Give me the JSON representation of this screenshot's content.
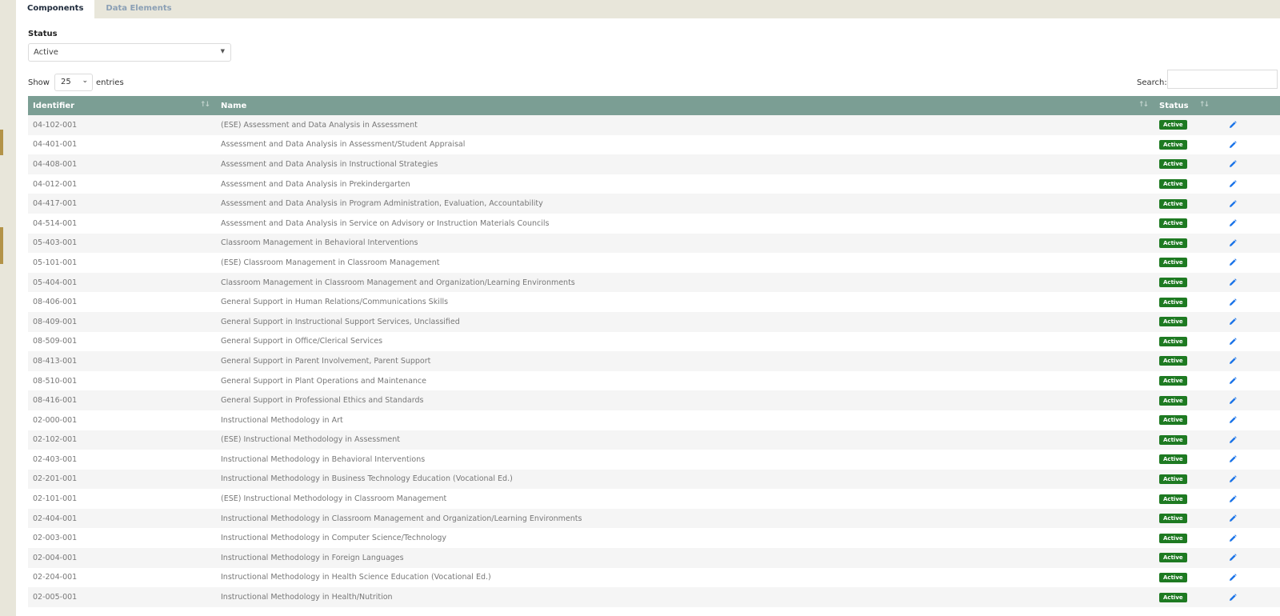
{
  "tabs": [
    {
      "label": "Components",
      "active": true
    },
    {
      "label": "Data Elements",
      "active": false
    }
  ],
  "filter": {
    "status_label": "Status",
    "status_value": "Active"
  },
  "length": {
    "show_label": "Show",
    "value": "25",
    "entries_label": "entries"
  },
  "search": {
    "label": "Search:",
    "value": ""
  },
  "table": {
    "columns": [
      "Identifier",
      "Name",
      "Status",
      ""
    ],
    "rows": [
      {
        "id": "04-102-001",
        "name": "(ESE) Assessment and Data Analysis in Assessment",
        "status": "Active"
      },
      {
        "id": "04-401-001",
        "name": "Assessment and Data Analysis in Assessment/Student Appraisal",
        "status": "Active"
      },
      {
        "id": "04-408-001",
        "name": "Assessment and Data Analysis in Instructional Strategies",
        "status": "Active"
      },
      {
        "id": "04-012-001",
        "name": "Assessment and Data Analysis in Prekindergarten",
        "status": "Active"
      },
      {
        "id": "04-417-001",
        "name": "Assessment and Data Analysis in Program Administration, Evaluation, Accountability",
        "status": "Active"
      },
      {
        "id": "04-514-001",
        "name": "Assessment and Data Analysis in Service on Advisory or Instruction Materials Councils",
        "status": "Active"
      },
      {
        "id": "05-403-001",
        "name": "Classroom Management in Behavioral Interventions",
        "status": "Active"
      },
      {
        "id": "05-101-001",
        "name": "(ESE) Classroom Management in Classroom Management",
        "status": "Active"
      },
      {
        "id": "05-404-001",
        "name": "Classroom Management in Classroom Management and Organization/Learning Environments",
        "status": "Active"
      },
      {
        "id": "08-406-001",
        "name": "General Support in Human Relations/Communications Skills",
        "status": "Active"
      },
      {
        "id": "08-409-001",
        "name": "General Support in Instructional Support Services, Unclassified",
        "status": "Active"
      },
      {
        "id": "08-509-001",
        "name": "General Support in Office/Clerical Services",
        "status": "Active"
      },
      {
        "id": "08-413-001",
        "name": "General Support in Parent Involvement, Parent Support",
        "status": "Active"
      },
      {
        "id": "08-510-001",
        "name": "General Support in Plant Operations and Maintenance",
        "status": "Active"
      },
      {
        "id": "08-416-001",
        "name": "General Support in Professional Ethics and Standards",
        "status": "Active"
      },
      {
        "id": "02-000-001",
        "name": "Instructional Methodology in Art",
        "status": "Active"
      },
      {
        "id": "02-102-001",
        "name": "(ESE) Instructional Methodology in Assessment",
        "status": "Active"
      },
      {
        "id": "02-403-001",
        "name": "Instructional Methodology in Behavioral Interventions",
        "status": "Active"
      },
      {
        "id": "02-201-001",
        "name": "Instructional Methodology in Business Technology Education (Vocational Ed.)",
        "status": "Active"
      },
      {
        "id": "02-101-001",
        "name": "(ESE) Instructional Methodology in Classroom Management",
        "status": "Active"
      },
      {
        "id": "02-404-001",
        "name": "Instructional Methodology in Classroom Management and Organization/Learning Environments",
        "status": "Active"
      },
      {
        "id": "02-003-001",
        "name": "Instructional Methodology in Computer Science/Technology",
        "status": "Active"
      },
      {
        "id": "02-004-001",
        "name": "Instructional Methodology in Foreign Languages",
        "status": "Active"
      },
      {
        "id": "02-204-001",
        "name": "Instructional Methodology in Health Science Education (Vocational Ed.)",
        "status": "Active"
      },
      {
        "id": "02-005-001",
        "name": "Instructional Methodology in Health/Nutrition",
        "status": "Active"
      }
    ]
  },
  "colors": {
    "header_bg": "#7b9e94",
    "badge_active": "#1e7a22",
    "edit_icon": "#1a73e8",
    "page_bg": "#e8e6da",
    "accent_gold": "#b39348"
  },
  "icons": {
    "edit": "pencil-icon",
    "sort": "sort-arrows-icon",
    "select_caret": "caret-down-icon"
  }
}
